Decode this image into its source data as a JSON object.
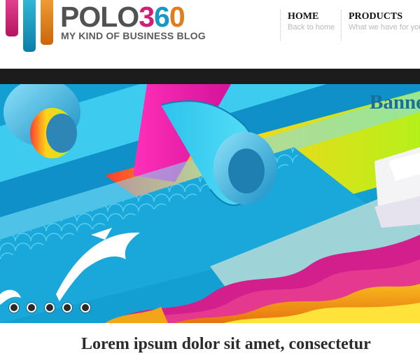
{
  "logo": {
    "word_main": "POLO",
    "word_digits": [
      "3",
      "6",
      "0"
    ],
    "tagline": "MY KIND OF BUSINESS BLOG",
    "colors": {
      "magenta": "#cf1f79",
      "blue": "#1699c5",
      "orange": "#e07d1c",
      "gray": "#505254"
    }
  },
  "nav": {
    "items": [
      {
        "label": "HOME",
        "sublabel": "Back to home"
      },
      {
        "label": "PRODUCTS",
        "sublabel": "What we have for you"
      }
    ]
  },
  "banner": {
    "title": "Banner",
    "slider_dots": 5,
    "active_dot": 1
  },
  "post": {
    "title": "Lorem ipsum dolor sit amet, consectetur"
  }
}
